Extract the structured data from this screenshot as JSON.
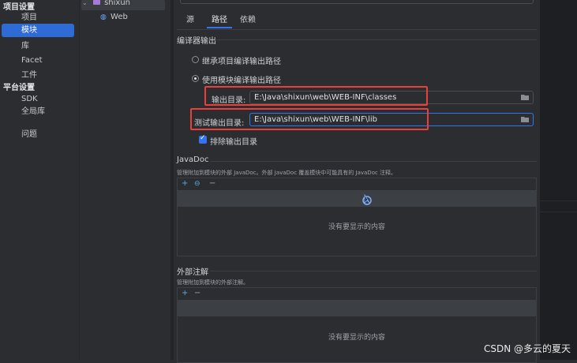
{
  "nav": {
    "items": [
      {
        "label": "项目设置",
        "kind": "head"
      },
      {
        "label": "项目",
        "kind": "sub"
      },
      {
        "label": "模块",
        "kind": "sub",
        "selected": true
      },
      {
        "label": "库",
        "kind": "sub"
      },
      {
        "label": "Facet",
        "kind": "sub"
      },
      {
        "label": "工件",
        "kind": "sub"
      },
      {
        "label": "平台设置",
        "kind": "head"
      },
      {
        "label": "SDK",
        "kind": "sub"
      },
      {
        "label": "全局库",
        "kind": "sub"
      },
      {
        "label": "问题",
        "kind": "sub"
      }
    ]
  },
  "tree": {
    "root": "shixun",
    "child": "Web"
  },
  "tabs": [
    {
      "label": "源"
    },
    {
      "label": "路径",
      "active": true
    },
    {
      "label": "依赖"
    }
  ],
  "compiler": {
    "title": "编译器输出",
    "inherit_label": "继承项目编译输出路径",
    "module_label": "使用模块编译输出路径",
    "output_label": "输出目录:",
    "output_value": "E:\\Java\\shixun\\web\\WEB-INF\\classes",
    "test_label": "测试输出目录:",
    "test_value": "E:\\Java\\shixun\\web\\WEB-INF\\lib",
    "exclude_label": "排除输出目录"
  },
  "javadoc": {
    "title": "JavaDoc",
    "desc": "管理附加到模块的外部 JavaDoc。外部 JavaDoc 覆盖模块中可能具有的 JavaDoc 注释。",
    "empty": "没有要显示的内容"
  },
  "annotations": {
    "title": "外部注解",
    "desc": "管理附加到模块的外部注解。",
    "empty": "没有要显示的内容"
  },
  "watermark": "CSDN @多云的夏天",
  "colors": {
    "accent": "#3574f0",
    "highlight": "#e8413b",
    "selected": "#2e6bd4"
  }
}
